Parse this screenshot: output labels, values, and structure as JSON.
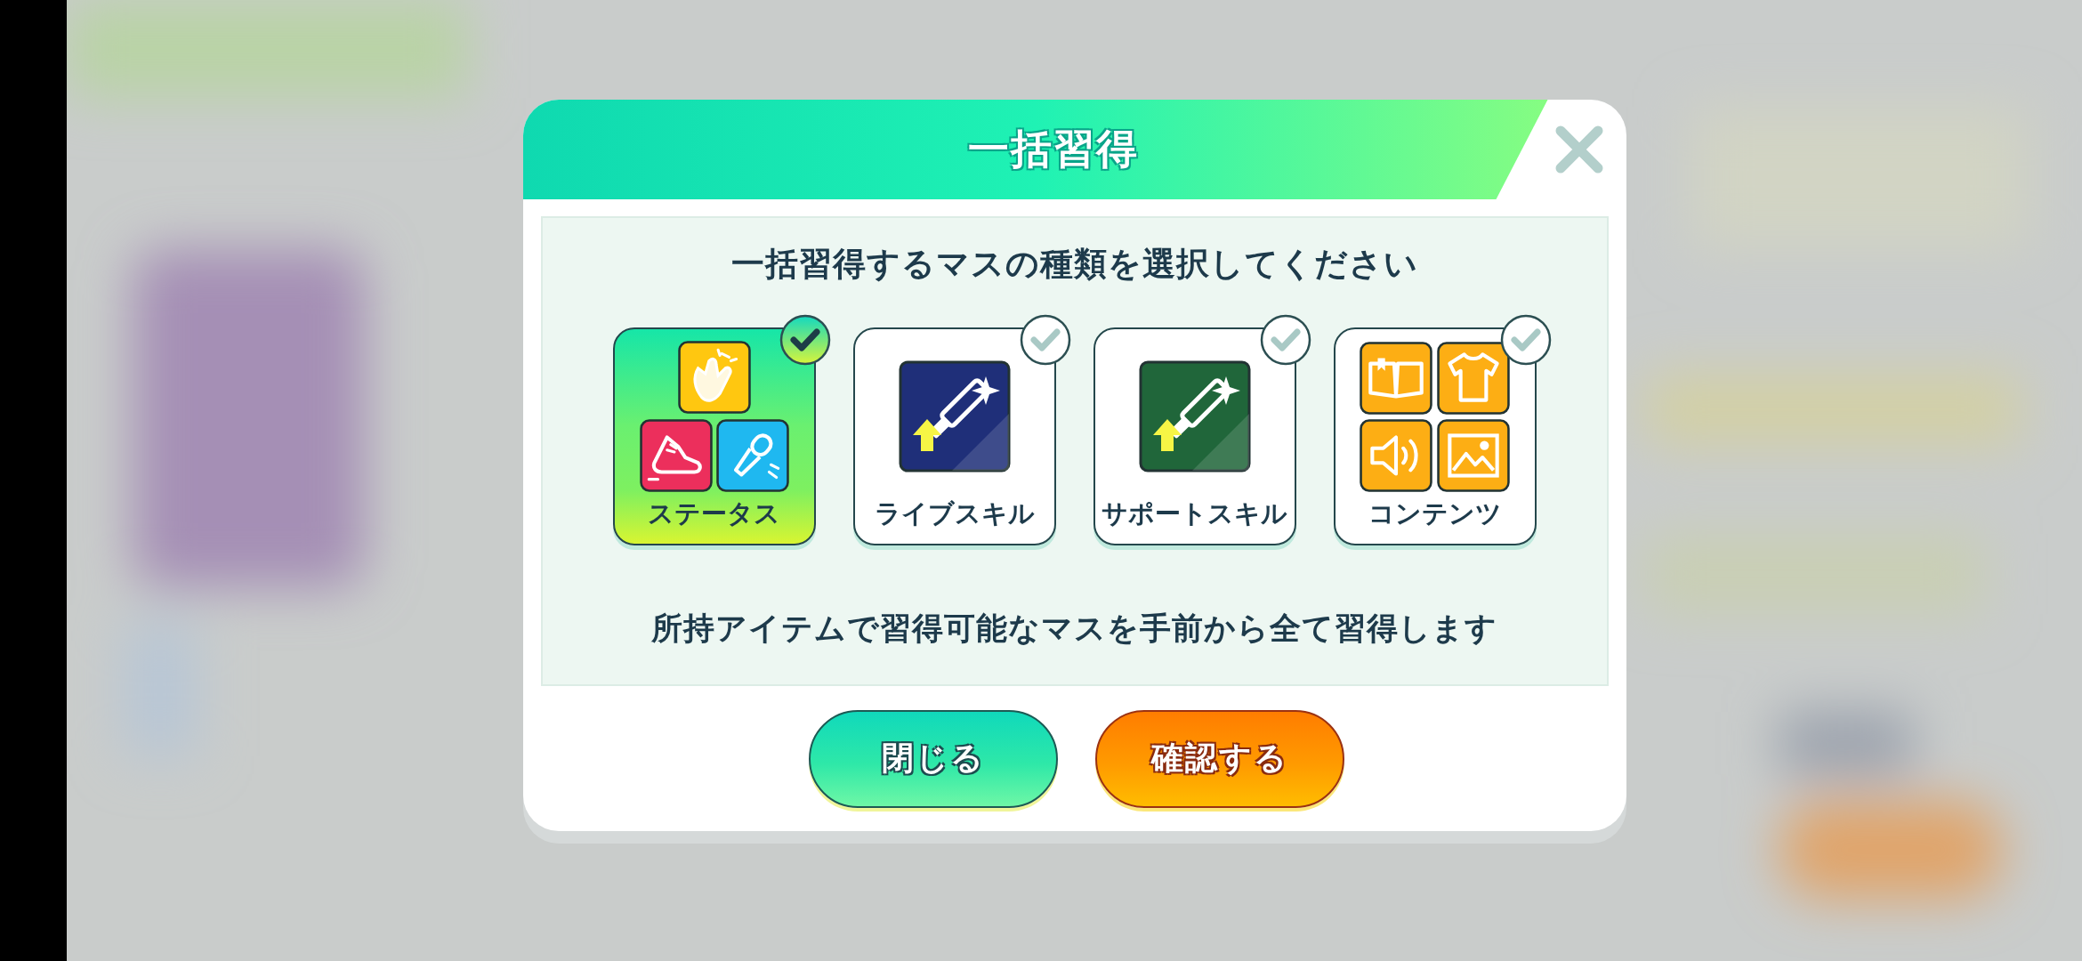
{
  "dialog": {
    "title": "一括習得",
    "prompt": "一括習得するマスの種類を選択してください",
    "options": [
      {
        "kind": "status",
        "label": "ステータス",
        "selected": true
      },
      {
        "kind": "live_skill",
        "label": "ライブスキル",
        "selected": false
      },
      {
        "kind": "support_skill",
        "label": "サポートスキル",
        "selected": false
      },
      {
        "kind": "contents",
        "label": "コンテンツ",
        "selected": false
      }
    ],
    "note": "所持アイテムで習得可能なマスを手前から全て習得します",
    "buttons": [
      {
        "kind": "close",
        "label": "閉じる"
      },
      {
        "kind": "confirm",
        "label": "確認する"
      }
    ]
  }
}
